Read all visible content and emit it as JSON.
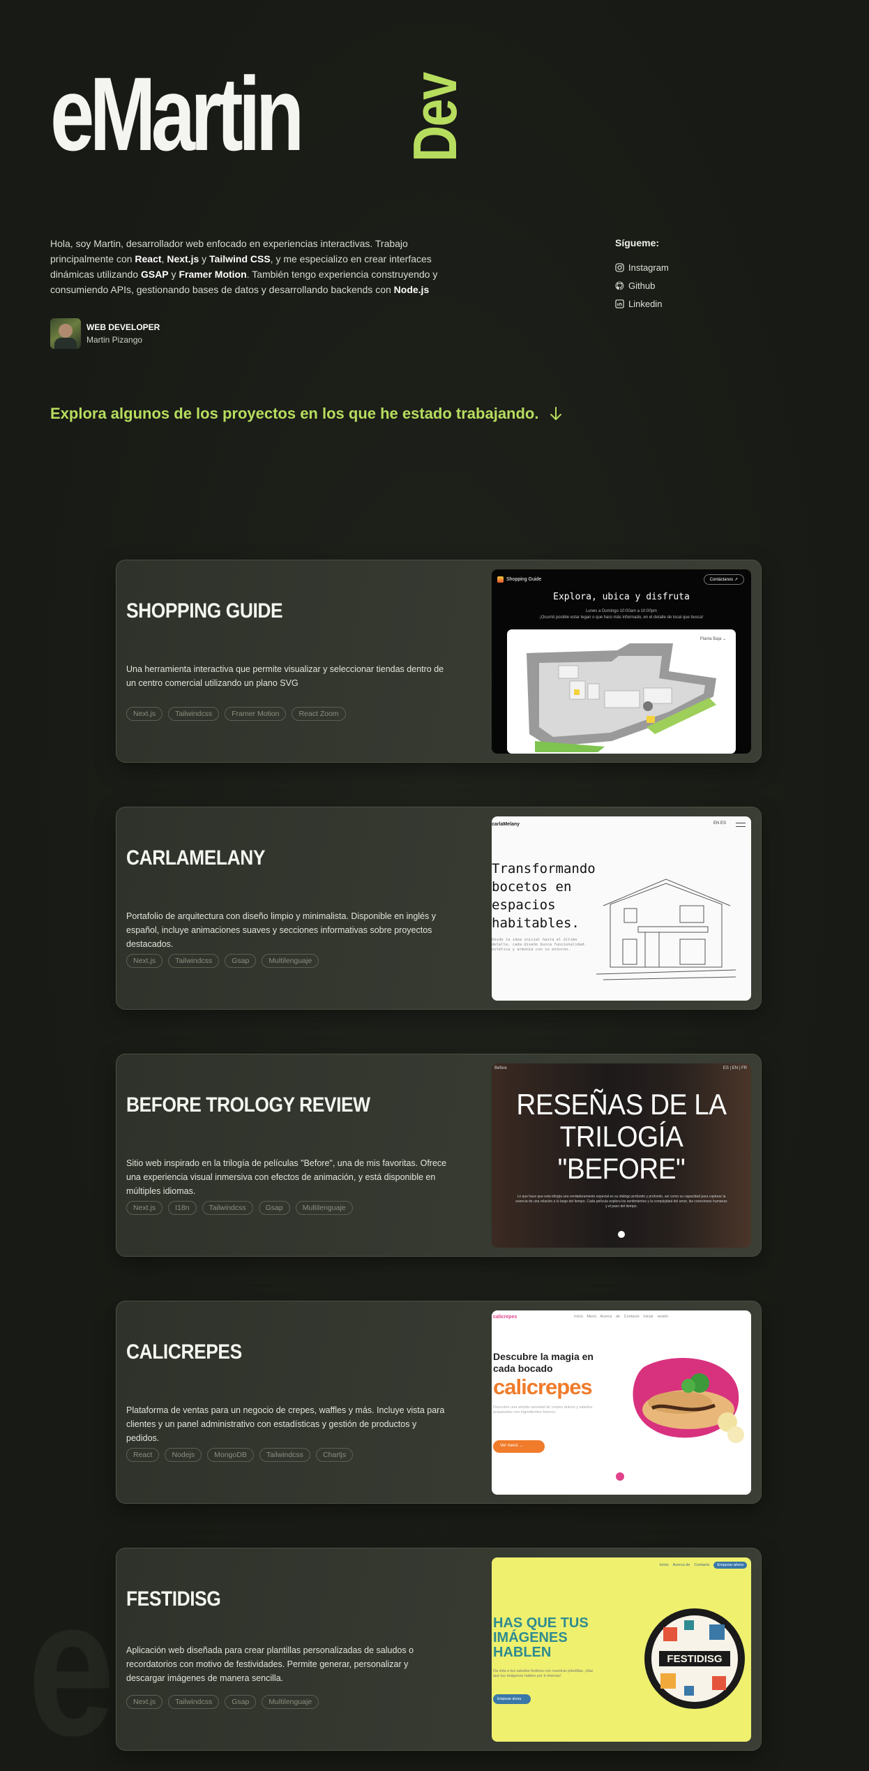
{
  "brand": {
    "name": "eMartin",
    "suffix": "Dev",
    "accent": "#b7dd5e"
  },
  "intro": {
    "p1": "Hola, soy Martin, desarrollador web enfocado en experiencias interactivas. Trabajo principalmente con ",
    "t1": "React",
    "p2": ", ",
    "t2": "Next.js",
    "p3": " y ",
    "t3": "Tailwind CSS",
    "p4": ", y me especializo en crear interfaces dinámicas utilizando ",
    "t4": "GSAP",
    "p5": " y ",
    "t5": "Framer Motion",
    "p6": ". También tengo experiencia construyendo y consumiendo APIs, gestionando bases de datos y desarrollando backends con ",
    "t6": "Node.js"
  },
  "author": {
    "role": "WEB DEVELOPER",
    "name": "Martin Pizango"
  },
  "follow": {
    "title": "Sígueme:",
    "links": [
      {
        "label": "Instagram",
        "icon": "instagram-icon"
      },
      {
        "label": "Github",
        "icon": "github-icon"
      },
      {
        "label": "Linkedin",
        "icon": "linkedin-icon"
      }
    ]
  },
  "explore": {
    "text": "Explora algunos de los proyectos en los que he estado trabajando.",
    "icon": "arrow-down-icon"
  },
  "projects": [
    {
      "title": "SHOPPING GUIDE",
      "description": "Una herramienta interactiva que permite visualizar y seleccionar tiendas dentro de un centro comercial utilizando un plano SVG",
      "tags": [
        "Next.js",
        "Tailwindcss",
        "Framer Motion",
        "React Zoom"
      ],
      "shot": {
        "logo": "Shopping Guide",
        "button": "Contáctanos ↗",
        "heading": "Explora, ubica y disfruta",
        "sub1": "Lunes a Domingo 10:00am a 10:00pm",
        "sub2": "¡Ocurrió posible estar legan o que haro más informado, en el detalle de local que busca!",
        "floor": "Planta Baja ⌄"
      }
    },
    {
      "title": "CARLAMELANY",
      "description": "Portafolio de arquitectura con diseño limpio y minimalista. Disponible en inglés y español, incluye animaciones suaves y secciones informativas sobre proyectos destacados.",
      "tags": [
        "Next.js",
        "Tailwindcss",
        "Gsap",
        "Multilenguaje"
      ],
      "shot": {
        "logo": "carlaMelany",
        "lang": "EN  ES",
        "heading": "Transformando bocetos en espacios habitables.",
        "text": "Desde la idea inicial hasta el último detalle, cada diseño busca funcionalidad, estética y armonía con su entorno."
      }
    },
    {
      "title": "BEFORE TROLOGY REVIEW",
      "description": "Sitio web inspirado en la trilogía de películas \"Before\", una de mis favoritas. Ofrece una experiencia visual inmersiva con efectos de animación, y está disponible en múltiples idiomas.",
      "tags": [
        "Next.js",
        "I18n",
        "Tailwindcss",
        "Gsap",
        "Multilenguaje"
      ],
      "shot": {
        "logo": "Before",
        "lang": "ES | EN | FR",
        "heading": "RESEÑAS DE LA TRILOGÍA \"BEFORE\"",
        "text": "Lo que hace que esta trilogía sea verdaderamente especial es su diálogo profundo y profundo, así como su capacidad para capturar la esencia de una relación a lo largo del tiempo. Cada película explora los sentimientos y la complejidad del amor, las conexiones humanas y el paso del tiempo."
      }
    },
    {
      "title": "CALICREPES",
      "description": "Plataforma de ventas para un negocio de crepes, waffles y más. Incluye vista para clientes y un panel administrativo con estadísticas y gestión de productos y pedidos.",
      "tags": [
        "React",
        "Nodejs",
        "MongoDB",
        "Tailwindcss",
        "Chartjs"
      ],
      "shot": {
        "logo": "calicrepes",
        "nav": "Inicio  Menú  Acerca de  Contacto  Iniciar sesión",
        "heading": "Descubre la magia en cada bocado",
        "brand": "calicrepes",
        "text": "Descubre una amplia variedad de crepes dulces y salados preparados con ingredientes frescos.",
        "cta": "Ver menú  →"
      }
    },
    {
      "title": "FESTIDISG",
      "description": "Aplicación web diseñada para crear plantillas personalizadas de saludos o recordatorios con motivo de festividades. Permite generar, personalizar y descargar imágenes de manera sencilla.",
      "tags": [
        "Next.js",
        "Tailwindcss",
        "Gsap",
        "Multilenguaje"
      ],
      "shot": {
        "nav1": "Inicio",
        "nav2": "Acerca de",
        "nav3": "Contacto",
        "cta_nav": "Empezar ahora",
        "heading": "HAS QUE TUS IMÁGENES HABLEN",
        "text": "Da vida a tus saludos festivos con nuestras plantillas. ¡Haz que tus imágenes hablen por ti mismas!",
        "cta": "Empezar ahora",
        "badge": "FESTIDISG"
      }
    }
  ]
}
